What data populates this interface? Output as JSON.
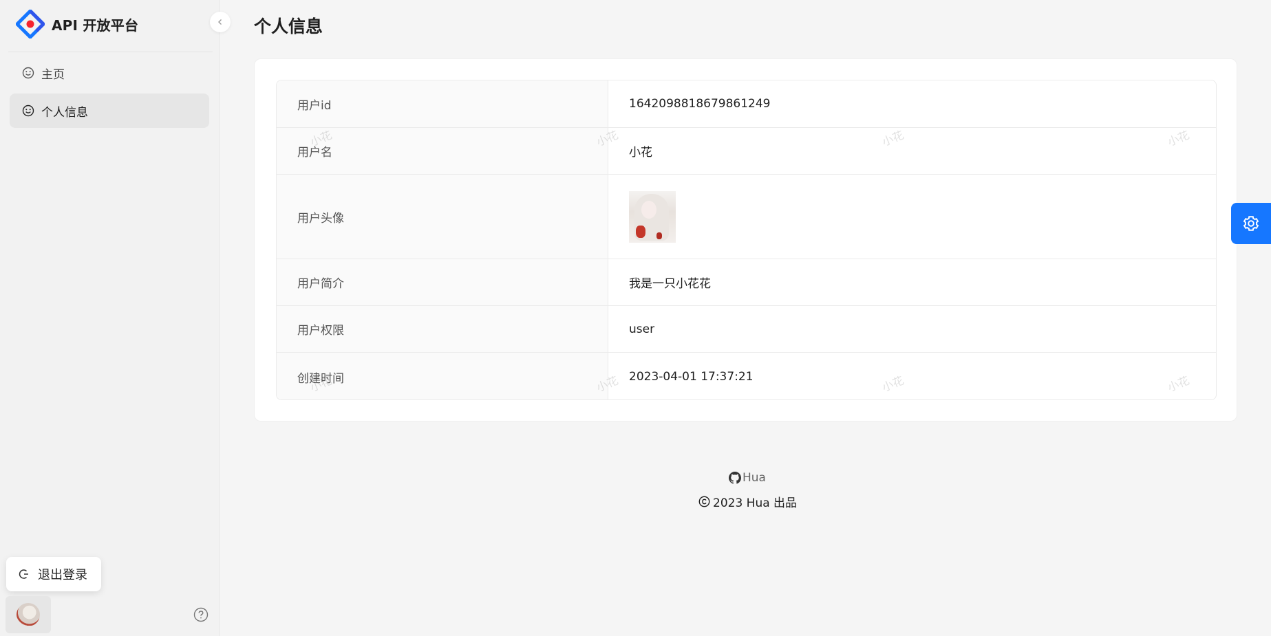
{
  "app": {
    "title": "API 开放平台"
  },
  "sidebar": {
    "items": [
      {
        "label": "主页",
        "icon": "smile-icon"
      },
      {
        "label": "个人信息",
        "icon": "smile-icon"
      }
    ],
    "logout_label": "退出登录"
  },
  "page": {
    "title": "个人信息"
  },
  "profile": {
    "rows": [
      {
        "label": "用户id",
        "value": "1642098818679861249"
      },
      {
        "label": "用户名",
        "value": "小花"
      },
      {
        "label": "用户头像",
        "value": ""
      },
      {
        "label": "用户简介",
        "value": "我是一只小花花"
      },
      {
        "label": "用户权限",
        "value": "user"
      },
      {
        "label": "创建时间",
        "value": "2023-04-01 17:37:21"
      }
    ]
  },
  "watermark": {
    "text": "小花"
  },
  "footer": {
    "link_label": "Hua",
    "copyright": "2023 Hua 出品"
  },
  "colors": {
    "accent": "#1677ff",
    "sidebar_bg": "#f2f2f2",
    "selected_bg": "#e6e6e6"
  }
}
